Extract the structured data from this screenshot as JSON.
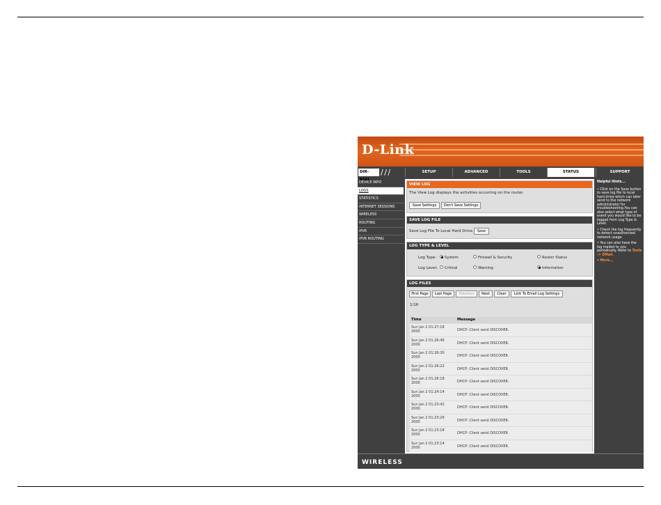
{
  "brand": {
    "logo": "D-Link",
    "model": "DIR-816L",
    "footer": "WIRELESS"
  },
  "tabs": [
    "SETUP",
    "ADVANCED",
    "TOOLS",
    "STATUS",
    "SUPPORT"
  ],
  "sidebar": [
    "DEVICE INFO",
    "LOGS",
    "STATISTICS",
    "INTERNET SESSIONS",
    "WIRELESS",
    "ROUTING",
    "IPV6",
    "IPV6 ROUTING"
  ],
  "view_log": {
    "title": "VIEW LOG",
    "description": "The View Log displays the activities occurring on the router.",
    "save_btn": "Save Settings",
    "dont_save_btn": "Don't Save Settings"
  },
  "save_log": {
    "title": "SAVE LOG FILE",
    "label": "Save Log File To Local Hard Drive.",
    "save_btn": "Save"
  },
  "log_type": {
    "title": "LOG TYPE & LEVEL",
    "type_label": "Log Type:",
    "types": [
      "System",
      "Firewall & Security",
      "Router Status"
    ],
    "level_label": "Log Level:",
    "levels": [
      "Critical",
      "Warning",
      "Information"
    ],
    "selected_type": "System",
    "selected_level": "Information"
  },
  "log_files": {
    "title": "LOG FILES",
    "buttons": [
      "First Page",
      "Last Page",
      "Previous",
      "Next",
      "Clear",
      "Link To Email Log Settings"
    ],
    "page": "1/16",
    "col_time": "Time",
    "col_message": "Message",
    "rows": [
      {
        "time": "Sun Jan 2 01:27:18 2000",
        "message": "DHCP: Client send DISCOVER."
      },
      {
        "time": "Sun Jan 2 01:26:46 2000",
        "message": "DHCP: Client send DISCOVER."
      },
      {
        "time": "Sun Jan 2 01:26:30 2000",
        "message": "DHCP: Client send DISCOVER."
      },
      {
        "time": "Sun Jan 2 01:26:22 2000",
        "message": "DHCP: Client send DISCOVER."
      },
      {
        "time": "Sun Jan 2 01:26:18 2000",
        "message": "DHCP: Client send DISCOVER."
      },
      {
        "time": "Sun Jan 2 01:24:14 2000",
        "message": "DHCP: Client send DISCOVER."
      },
      {
        "time": "Sun Jan 2 01:23:42 2000",
        "message": "DHCP: Client send DISCOVER."
      },
      {
        "time": "Sun Jan 2 01:23:26 2000",
        "message": "DHCP: Client send DISCOVER."
      },
      {
        "time": "Sun Jan 2 01:23:18 2000",
        "message": "DHCP: Client send DISCOVER."
      },
      {
        "time": "Sun Jan 2 01:23:14 2000",
        "message": "DHCP: Client send DISCOVER."
      }
    ]
  },
  "help": {
    "title": "Helpful Hints...",
    "hint1": "Click on the Save button to save log file to local hard drive which can later send to the network administrator for troubleshooting.You can also select what type of event you would like to be logged from Log Type & Level.",
    "hint2": "Check the log frequently to detect unauthorized network usage.",
    "hint3_a": "You can also have the log mailed to you periodically. Refer to",
    "hint3_link": "Tools -> EMail.",
    "more": "More..."
  }
}
